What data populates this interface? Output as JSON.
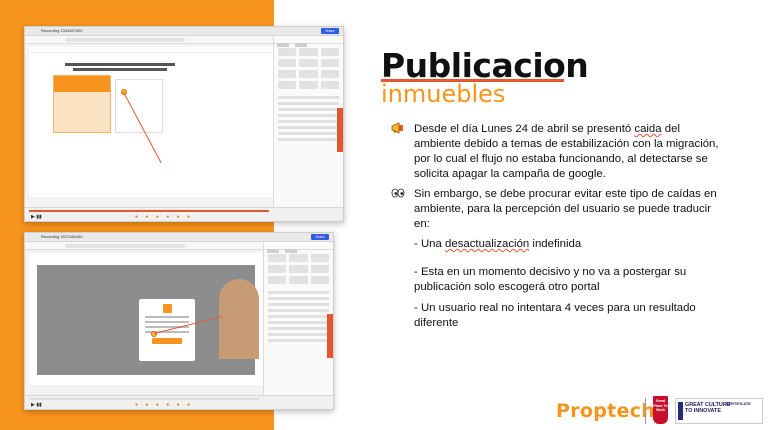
{
  "slide": {
    "title": "Publicacion",
    "subtitle": "inmuebles",
    "colors": {
      "accent_orange": "#f7941d",
      "underline_red": "#e4572e",
      "text": "#111111"
    },
    "bullets": [
      {
        "icon": "megaphone-icon",
        "text_before": "Desde el día Lunes 24 de abril se presentó ",
        "text_marked": "caida",
        "text_after": " del ambiente debido a temas de estabilización con la migración, por lo cual el flujo no estaba funcionando, al detectarse se solicita apagar la campaña de google."
      },
      {
        "icon": "eyes-icon",
        "text": "Sin embargo, se debe procurar evitar este tipo de caídas en ambiente, para la percepción del usuario se puede traducir en:"
      }
    ],
    "items": {
      "item1_before": "- Una ",
      "item1_marked": "desactualización",
      "item1_after": " indefinida",
      "item2": "- Esta en un momento decisivo y no va a postergar su publicación solo escogerá otro portal",
      "item3": "- Un usuario real no intentara 4 veces para un resultado diferente"
    }
  },
  "screenshots": {
    "top": {
      "window_title": "Recording 2334597400",
      "share_label": "Share"
    },
    "bottom": {
      "window_title": "Recording 3972381060",
      "share_label": "Share"
    }
  },
  "footer": {
    "brand": "Proptech",
    "gptw_badge": "Great Place To Work",
    "culture_badge_line1": "GREAT CULTURE",
    "culture_badge_line2": "TO INNOVATE",
    "culture_badge_cert": "CERTIFICATE"
  }
}
